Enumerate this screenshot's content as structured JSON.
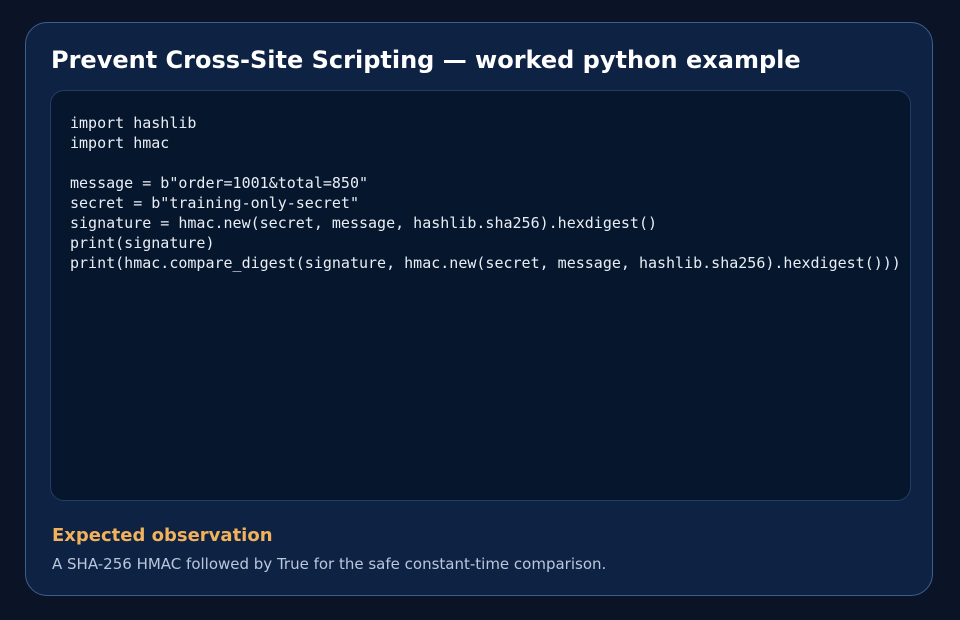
{
  "card": {
    "title": "Prevent Cross-Site Scripting — worked python example"
  },
  "code": {
    "language": "python",
    "lines": [
      "import hashlib",
      "import hmac",
      "",
      "message = b\"order=1001&total=850\"",
      "secret = b\"training-only-secret\"",
      "signature = hmac.new(secret, message, hashlib.sha256).hexdigest()",
      "print(signature)",
      "print(hmac.compare_digest(signature, hmac.new(secret, message, hashlib.sha256).hexdigest()))"
    ]
  },
  "observation": {
    "heading": "Expected observation",
    "text": "A SHA-256 HMAC followed by True for the safe constant-time comparison."
  },
  "colors": {
    "page_background": "#0a1426",
    "card_background": "#0e2244",
    "card_border": "#3e5f8e",
    "code_background": "#06172d",
    "code_text": "#e9eef6",
    "accent": "#f2b25c",
    "muted_text": "#b9c7dc"
  }
}
